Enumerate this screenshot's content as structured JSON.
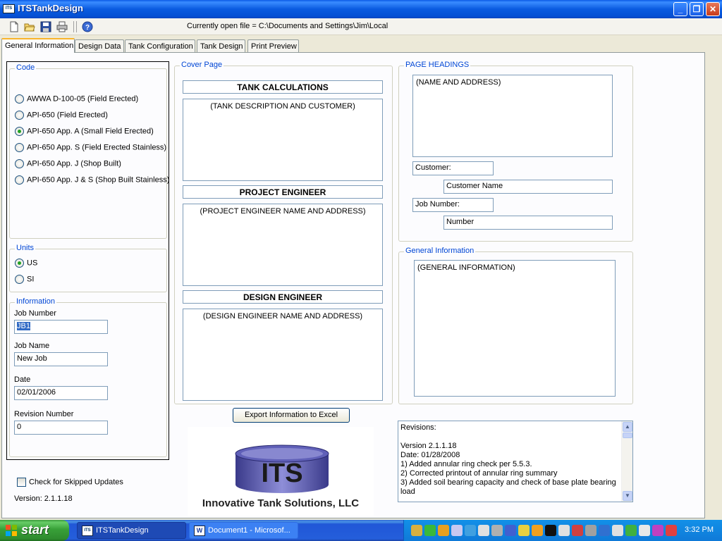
{
  "window": {
    "title": "ITSTankDesign",
    "app_icon_text": "ITS",
    "minimize": "_",
    "maximize": "❐",
    "close": "✕"
  },
  "toolbar": {
    "icons": [
      "new-icon",
      "open-icon",
      "save-icon",
      "print-icon",
      "help-icon"
    ],
    "open_file_label": "Currently open file = C:\\Documents and Settings\\Jim\\Local"
  },
  "tabs": [
    {
      "label": "General Information",
      "active": true
    },
    {
      "label": "Design Data",
      "active": false
    },
    {
      "label": "Tank Configuration",
      "active": false
    },
    {
      "label": "Tank Design",
      "active": false
    },
    {
      "label": "Print Preview",
      "active": false
    }
  ],
  "code": {
    "legend": "Code",
    "options": [
      {
        "label": "AWWA D-100-05 (Field Erected)",
        "selected": false
      },
      {
        "label": "API-650 (Field Erected)",
        "selected": false
      },
      {
        "label": "API-650 App. A (Small Field Erected)",
        "selected": true
      },
      {
        "label": "API-650 App. S (Field Erected Stainless)",
        "selected": false
      },
      {
        "label": "API-650 App. J (Shop Built)",
        "selected": false
      },
      {
        "label": "API-650 App. J & S (Shop Built Stainless)",
        "selected": false
      }
    ]
  },
  "units": {
    "legend": "Units",
    "options": [
      {
        "label": "US",
        "selected": true
      },
      {
        "label": "SI",
        "selected": false
      }
    ]
  },
  "information": {
    "legend": "Information",
    "job_number_label": "Job Number",
    "job_number_value": "JB1",
    "job_name_label": "Job Name",
    "job_name_value": "New Job",
    "date_label": "Date",
    "date_value": "02/01/2006",
    "revision_label": "Revision Number",
    "revision_value": "0"
  },
  "skip_updates_label": "Check for Skipped Updates",
  "version_label": "Version: 2.1.1.18",
  "cover_page": {
    "legend": "Cover Page",
    "tank_calc_header": "TANK CALCULATIONS",
    "tank_desc": "(TANK DESCRIPTION AND CUSTOMER)",
    "project_engineer_header": "PROJECT ENGINEER",
    "project_engineer_text": "(PROJECT ENGINEER NAME AND ADDRESS)",
    "design_engineer_header": "DESIGN ENGINEER",
    "design_engineer_text": "(DESIGN ENGINEER NAME AND ADDRESS)"
  },
  "export_button": "Export Information to Excel",
  "logo": {
    "letters": "ITS",
    "company": "Innovative Tank Solutions, LLC"
  },
  "page_headings": {
    "legend": "PAGE HEADINGS",
    "name_address": "(NAME AND ADDRESS)",
    "customer_label": "Customer:",
    "customer_value": "Customer Name",
    "job_number_label": "Job Number:",
    "job_number_value": "Number"
  },
  "general_information": {
    "legend": "General Information",
    "text": "(GENERAL INFORMATION)"
  },
  "revisions": {
    "lines": [
      "Revisions:",
      "",
      "Version 2.1.1.18",
      "Date: 01/28/2008",
      "1) Added annular ring check per 5.5.3.",
      "2) Corrected printout of annular ring summary",
      "3) Added soil bearing capacity and check of base plate bearing load"
    ]
  },
  "taskbar": {
    "start_label": "start",
    "items": [
      {
        "label": "ITSTankDesign",
        "active": true,
        "icon": "ITS"
      },
      {
        "label": "Document1 - Microsof...",
        "active": false,
        "icon": "W"
      }
    ],
    "clock": "3:32 PM"
  }
}
